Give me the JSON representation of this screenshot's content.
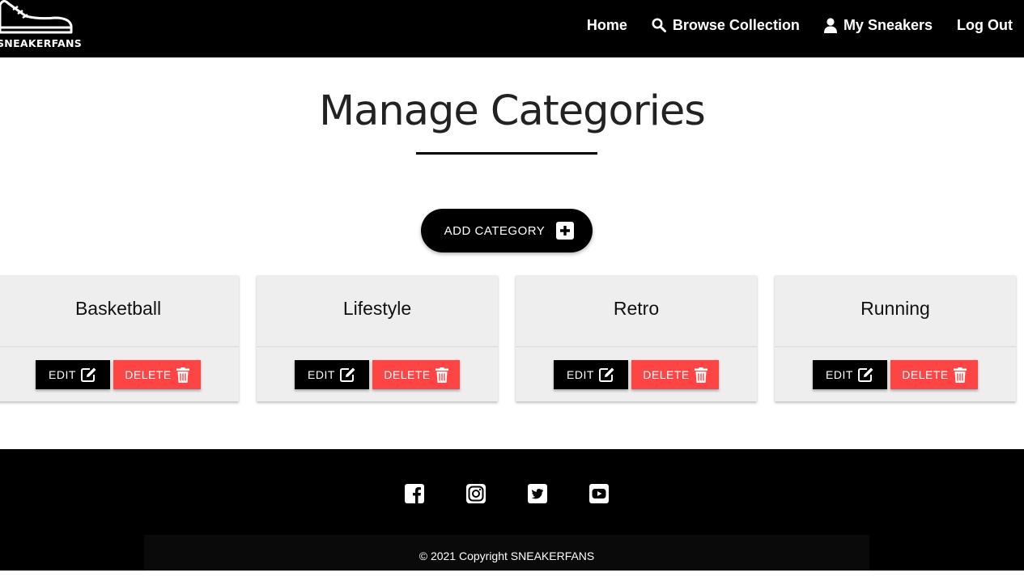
{
  "brand": {
    "name": "SNEAKERFANS",
    "logo_icon": "sneaker-icon"
  },
  "nav": {
    "home": "Home",
    "browse": "Browse Collection",
    "my_sneakers": "My Sneakers",
    "logout": "Log Out"
  },
  "page": {
    "title": "Manage Categories",
    "add_button": "ADD CATEGORY"
  },
  "categories": [
    {
      "name": "Basketball",
      "edit": "EDIT",
      "delete": "DELETE"
    },
    {
      "name": "Lifestyle",
      "edit": "EDIT",
      "delete": "DELETE"
    },
    {
      "name": "Retro",
      "edit": "EDIT",
      "delete": "DELETE"
    },
    {
      "name": "Running",
      "edit": "EDIT",
      "delete": "DELETE"
    }
  ],
  "footer": {
    "social": [
      "facebook-icon",
      "instagram-icon",
      "twitter-icon",
      "youtube-icon"
    ],
    "copyright": "© 2021 Copyright SNEAKERFANS"
  },
  "colors": {
    "nav_bg": "#000000",
    "delete": "#ff4444",
    "card_bg": "#eeeeee"
  }
}
